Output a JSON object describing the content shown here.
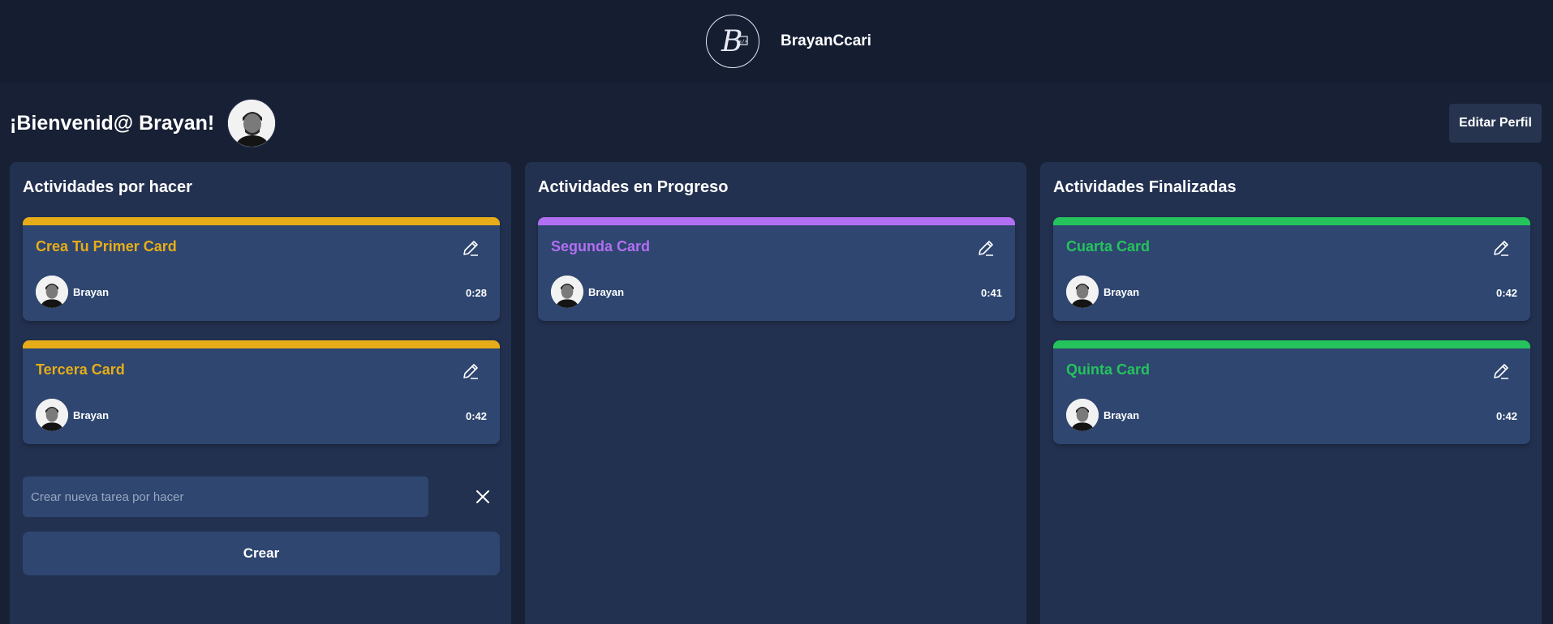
{
  "header": {
    "brand_name": "BrayanCcari",
    "logo_letter": "B",
    "logo_code": "</>"
  },
  "welcome": {
    "text": "¡Bienvenid@ Brayan!"
  },
  "profile": {
    "edit_label": "Editar Perfil"
  },
  "columns": [
    {
      "title": "Actividades por hacer",
      "accent": "#e7ad18",
      "cards": [
        {
          "title": "Crea Tu Primer Card",
          "user": "Brayan",
          "time": "0:28"
        },
        {
          "title": "Tercera Card",
          "user": "Brayan",
          "time": "0:42"
        }
      ],
      "new_task": {
        "placeholder": "Crear nueva tarea por hacer",
        "create_label": "Crear"
      }
    },
    {
      "title": "Actividades en Progreso",
      "accent": "#b36ff2",
      "cards": [
        {
          "title": "Segunda Card",
          "user": "Brayan",
          "time": "0:41"
        }
      ]
    },
    {
      "title": "Actividades Finalizadas",
      "accent": "#25c35c",
      "cards": [
        {
          "title": "Cuarta Card",
          "user": "Brayan",
          "time": "0:42"
        },
        {
          "title": "Quinta Card",
          "user": "Brayan",
          "time": "0:42"
        }
      ]
    }
  ],
  "icons": {
    "edit": "pencil-icon",
    "close": "close-icon"
  }
}
